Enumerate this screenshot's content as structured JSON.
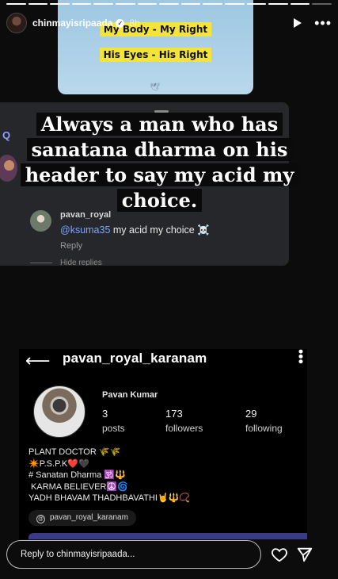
{
  "story": {
    "username": "chinmayisripaada",
    "time_ago": "8h",
    "progress_segments": 15,
    "progress_done": 14
  },
  "meme": {
    "line1": "My Body - My Right",
    "line2": "His Eyes - His Right"
  },
  "comment_card": {
    "username": "pavan_royal",
    "mention": "@ksuma35",
    "text": " my acid my choice ☠️",
    "reply": "Reply",
    "hide_replies": "Hide replies"
  },
  "caption": {
    "lines": [
      "Always a man who has",
      "sanatana dharma on his",
      "header to say my acid my",
      "choice."
    ]
  },
  "profile": {
    "handle": "pavan_royal_karanam",
    "name": "Pavan Kumar",
    "posts_count": "3",
    "posts_label": "posts",
    "followers_count": "173",
    "followers_label": "followers",
    "following_count": "29",
    "following_label": "following",
    "bio": "PLANT DOCTOR 🌾🌾\n✴️P.S.P.K❤️🖤\n# Sanatan Dharma 🕉️🔱\n KARMA BELIEVER☮️🌀\nYADH BHAVAM THADHBAVATHI🤘🔱📿",
    "threads_handle": "pavan_royal_karanam"
  },
  "reply_bar": {
    "placeholder": "Reply to chinmayisripaada..."
  },
  "colors": {
    "background": "#0c0c0d",
    "meme_highlight": "#f3e43b",
    "mention": "#7ea3ff"
  }
}
